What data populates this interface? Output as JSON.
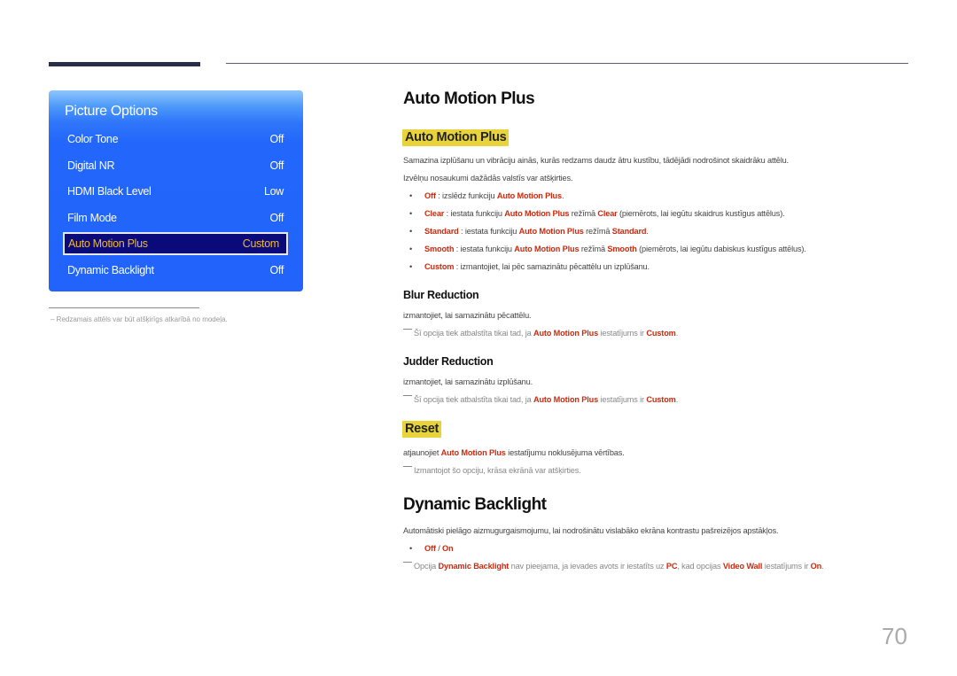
{
  "osd": {
    "title": "Picture Options",
    "items": [
      {
        "label": "Color Tone",
        "value": "Off"
      },
      {
        "label": "Digital NR",
        "value": "Off"
      },
      {
        "label": "HDMI Black Level",
        "value": "Low"
      },
      {
        "label": "Film Mode",
        "value": "Off"
      },
      {
        "label": "Auto Motion Plus",
        "value": "Custom",
        "selected": true
      },
      {
        "label": "Dynamic Backlight",
        "value": "Off"
      }
    ]
  },
  "footnote": "Redzamais attēls var būt atšķirīgs atkarībā no modeļa.",
  "section1": {
    "title": "Auto Motion Plus",
    "subtitle": "Auto Motion Plus",
    "desc1": "Samazina izplūšanu un vibrāciju ainās, kurās redzams daudz ātru kustību, tādējādi nodrošinot skaidrāku attēlu.",
    "desc2": "Izvēlņu nosaukumi dažādās valstīs var atšķirties.",
    "bullets": [
      {
        "key": "Off",
        "t1": " : izslēdz funkciju ",
        "r1": "Auto Motion Plus",
        "t2": ".",
        "r2": "",
        "t3": ""
      },
      {
        "key": "Clear",
        "t1": " : iestata funkciju ",
        "r1": "Auto Motion Plus",
        "t2": " režīmā ",
        "r2": "Clear",
        "t3": " (piemērots, lai iegūtu skaidrus kustīgus attēlus)."
      },
      {
        "key": "Standard",
        "t1": " : iestata funkciju ",
        "r1": "Auto Motion Plus",
        "t2": " režīmā ",
        "r2": "Standard",
        "t3": "."
      },
      {
        "key": "Smooth",
        "t1": " : iestata funkciju ",
        "r1": "Auto Motion Plus",
        "t2": " režīmā ",
        "r2": "Smooth",
        "t3": " (piemērots, lai iegūtu dabiskus kustīgus attēlus)."
      },
      {
        "key": "Custom",
        "t1": " : izmantojiet, lai pēc samazinātu pēcattēlu un izplūšanu.",
        "r1": "",
        "t2": "",
        "r2": "",
        "t3": ""
      }
    ],
    "blur": {
      "title": "Blur Reduction",
      "desc": "izmantojiet, lai samazinātu pēcattēlu.",
      "note_a": "Šī opcija tiek atbalstīta tikai tad, ja ",
      "note_r1": "Auto Motion Plus",
      "note_b": " iestatījums ir ",
      "note_r2": "Custom",
      "note_c": "."
    },
    "judder": {
      "title": "Judder Reduction",
      "desc": "izmantojiet, lai samazinātu izplūšanu.",
      "note_a": "Šī opcija tiek atbalstīta tikai tad, ja ",
      "note_r1": "Auto Motion Plus",
      "note_b": " iestatījums ir ",
      "note_r2": "Custom",
      "note_c": "."
    },
    "reset": {
      "title": "Reset",
      "desc_a": "atjaunojiet ",
      "desc_r": "Auto Motion Plus",
      "desc_b": " iestatījumu noklusējuma vērtības.",
      "note": "Izmantojot šo opciju, krāsa ekrānā var atšķirties."
    }
  },
  "section2": {
    "title": "Dynamic Backlight",
    "desc": "Automātiski pielāgo aizmugurgaismojumu, lai nodrošinātu vislabāko ekrāna kontrastu pašreizējos apstākļos.",
    "opt_off": "Off",
    "opt_sep": " / ",
    "opt_on": "On",
    "note_a": "Opcija ",
    "note_r1": "Dynamic Backlight",
    "note_b": " nav pieejama, ja ievades avots ir iestatīts uz ",
    "note_r2": "PC",
    "note_c": ", kad opcijas ",
    "note_r3": "Video Wall",
    "note_d": " iestatījums ir ",
    "note_r4": "On",
    "note_e": "."
  },
  "page_number": "70"
}
